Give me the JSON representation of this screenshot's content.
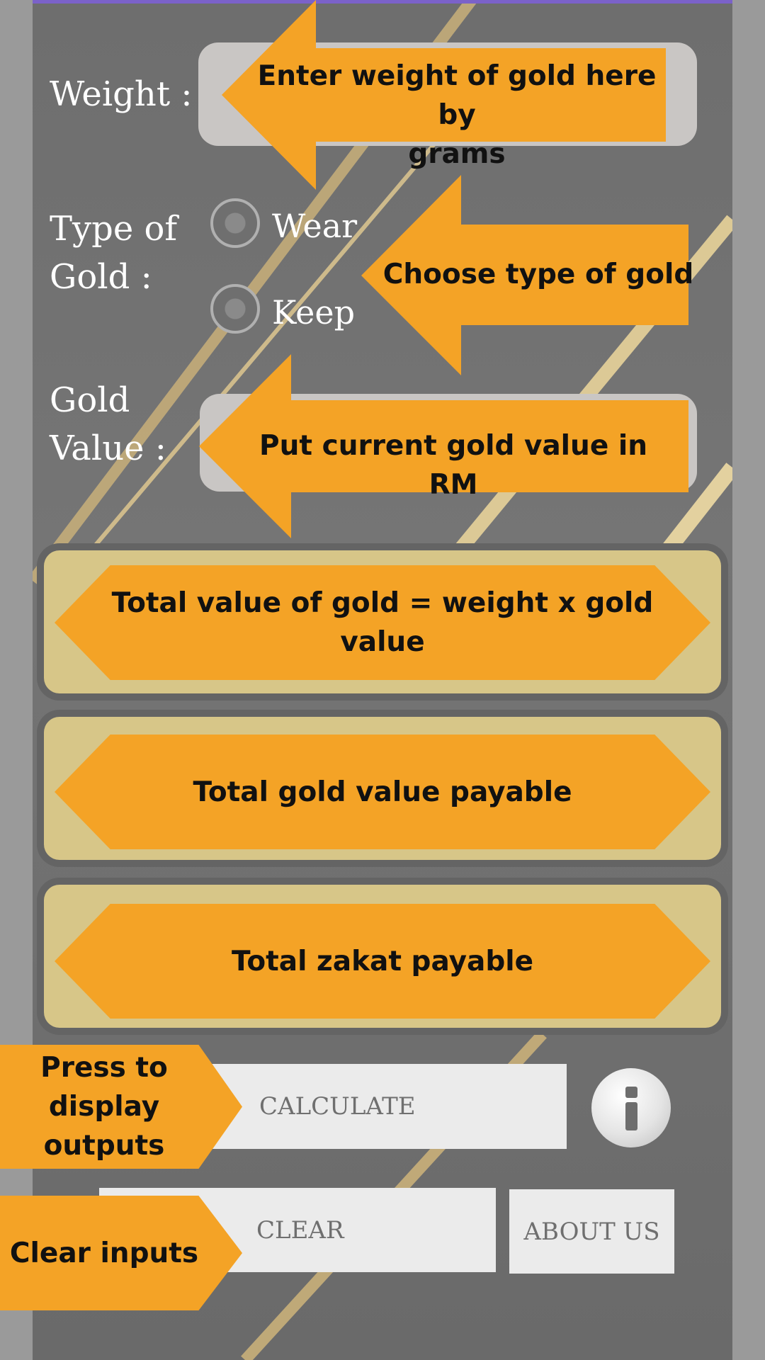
{
  "form": {
    "weight_label": "Weight :",
    "type_label_line1": "Type of",
    "type_label_line2": "Gold :",
    "gold_value_label_line1": "Gold",
    "gold_value_label_line2": "Value :",
    "options": [
      "Wear",
      "Keep"
    ],
    "weight_value": "",
    "gold_value_value": ""
  },
  "annotations": {
    "weight_line1": "Enter weight of gold here by",
    "weight_line2": "grams",
    "type": "Choose type of gold",
    "gold_value": "Put current gold value in RM",
    "total_value_line1": "Total value of gold = weight x gold",
    "total_value_line2": "value",
    "payable": "Total gold value payable",
    "zakat": "Total zakat payable",
    "press_line1": "Press to",
    "press_line2": "display",
    "press_line3": "outputs",
    "clear": "Clear inputs"
  },
  "buttons": {
    "calculate": "CALCULATE",
    "clear": "CLEAR",
    "about": "ABOUT US"
  },
  "colors": {
    "accent_orange": "#f4a326",
    "output_box": "#d7c688",
    "topbar": "#7b62c9"
  },
  "icons": {
    "info": "info-icon"
  }
}
